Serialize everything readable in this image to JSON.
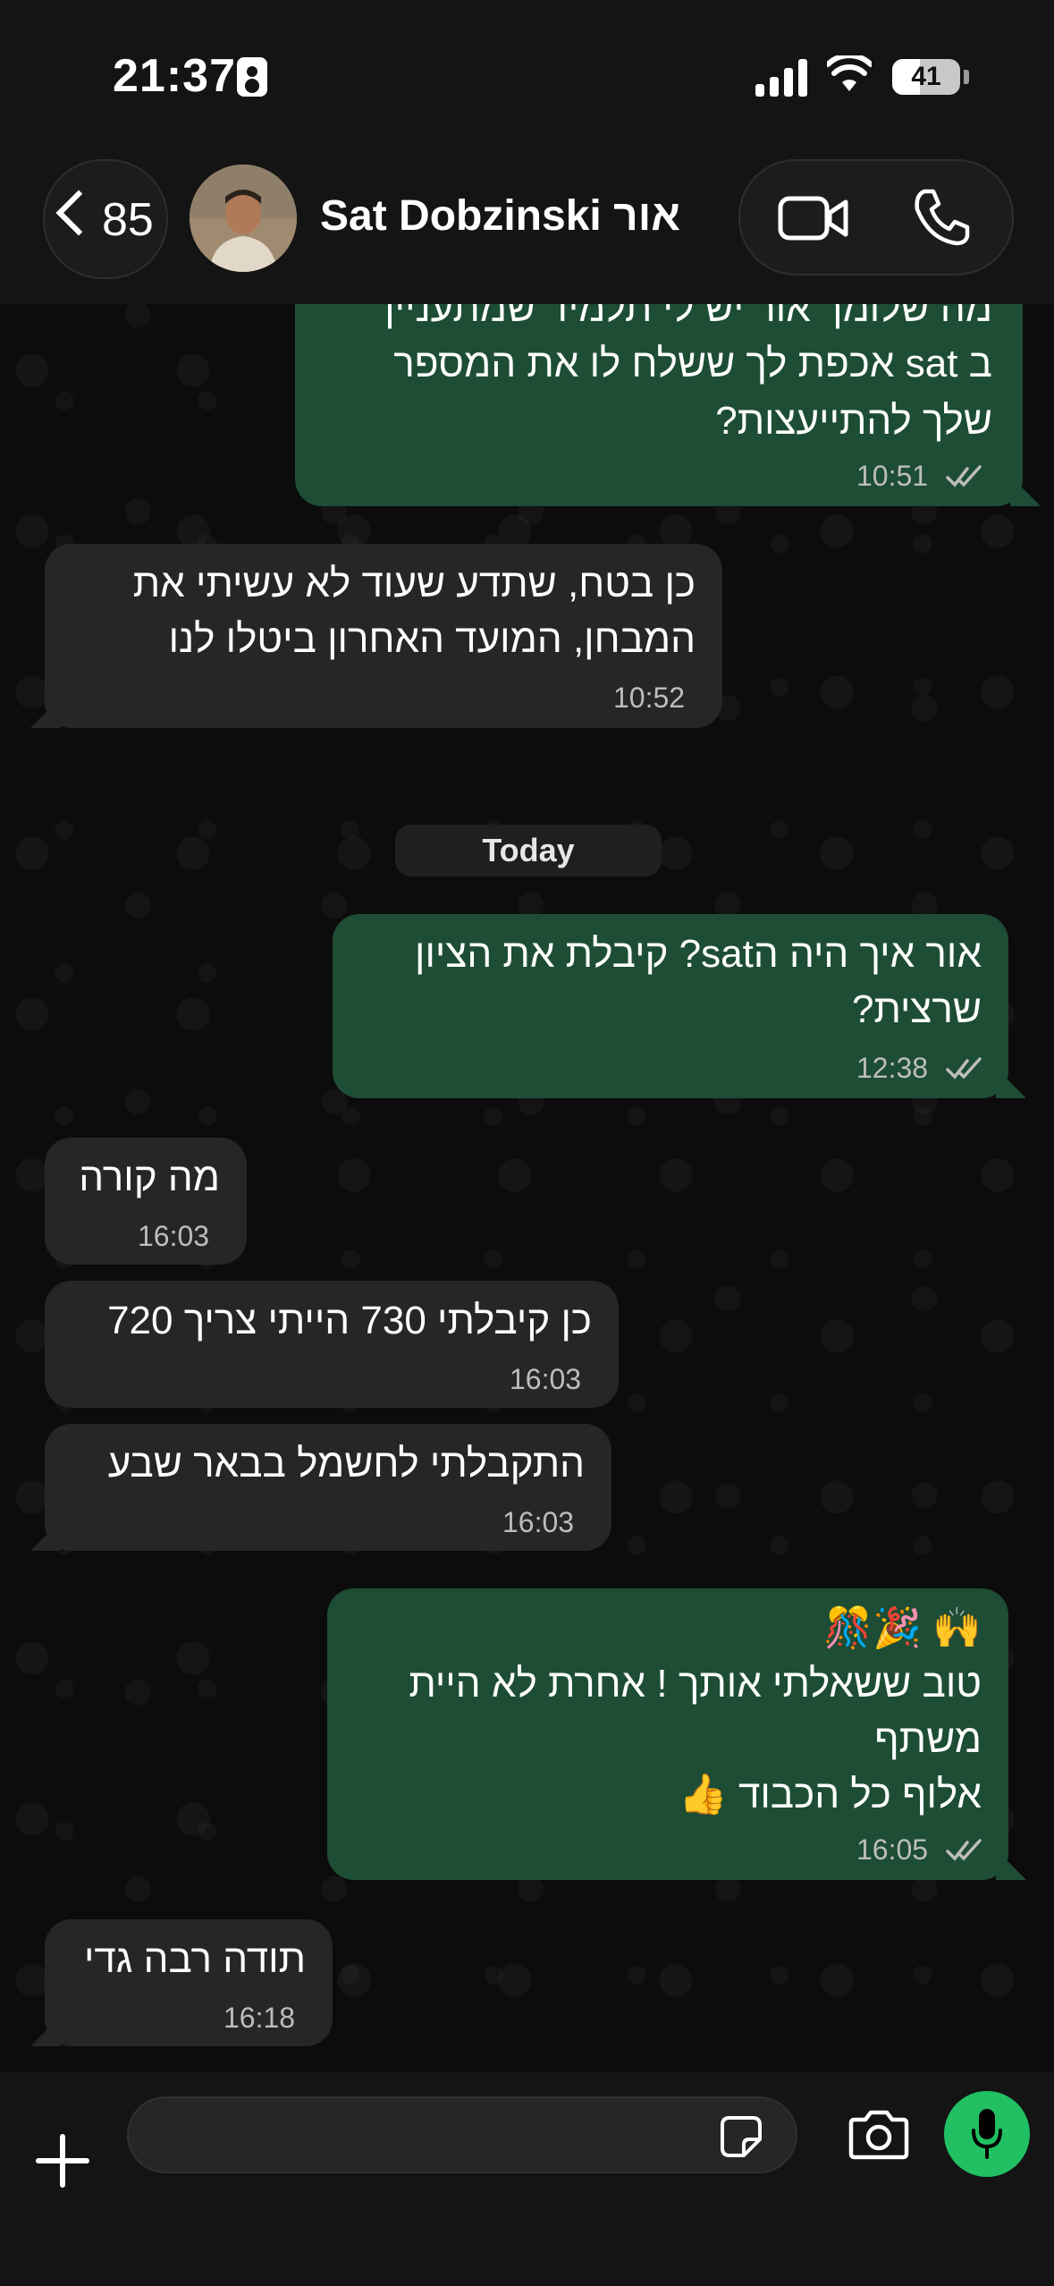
{
  "status_bar": {
    "time": "21:37",
    "battery": "41",
    "battery_level": 0.41
  },
  "header": {
    "back_count": "85",
    "contact_name": "Sat Dobzinski אור",
    "icons": [
      "chevron-left-icon",
      "video-call-icon",
      "phone-call-icon"
    ]
  },
  "messages": [
    {
      "direction": "outgoing",
      "lines": [
        "מה שלומך  אור יש לי תלמיד שמתעניין",
        "ב sat אכפת לך ששלח לו את המספר",
        "שלך להתייעצות?"
      ],
      "time": "10:51",
      "read": true
    },
    {
      "direction": "incoming",
      "lines": [
        "כן בטח, שתדע שעוד לא עשיתי את",
        "המבחן, המועד האחרון ביטלו לנו"
      ],
      "time": "10:52"
    },
    {
      "direction": "outgoing",
      "lines": [
        "אור  איך היה הsat? קיבלת את הציון",
        "שרצית?"
      ],
      "time": "12:38",
      "read": true
    },
    {
      "direction": "incoming",
      "lines": [
        "מה קורה"
      ],
      "time": "16:03"
    },
    {
      "direction": "incoming",
      "lines": [
        "כן קיבלתי 730 הייתי צריך 720"
      ],
      "time": "16:03"
    },
    {
      "direction": "incoming",
      "lines": [
        "התקבלתי לחשמל בבאר שבע"
      ],
      "time": "16:03"
    },
    {
      "direction": "outgoing",
      "lines": [
        "🙌 🎉🎊",
        "טוב ששאלתי אותך ! אחרת לא היית",
        "משתף",
        "אלוף כל הכבוד 👍"
      ],
      "time": "16:05",
      "read": true
    },
    {
      "direction": "incoming",
      "lines": [
        "תודה רבה גדי"
      ],
      "time": "16:18"
    }
  ],
  "date_separator": "Today",
  "composer": {
    "input_value": "",
    "icons": [
      "plus-icon",
      "sticker-icon",
      "camera-icon",
      "microphone-icon"
    ]
  },
  "colors": {
    "outgoing_bubble": "#1e4d35",
    "incoming_bubble": "#262626",
    "mic_button": "#21c063",
    "bar_background": "#141414"
  }
}
